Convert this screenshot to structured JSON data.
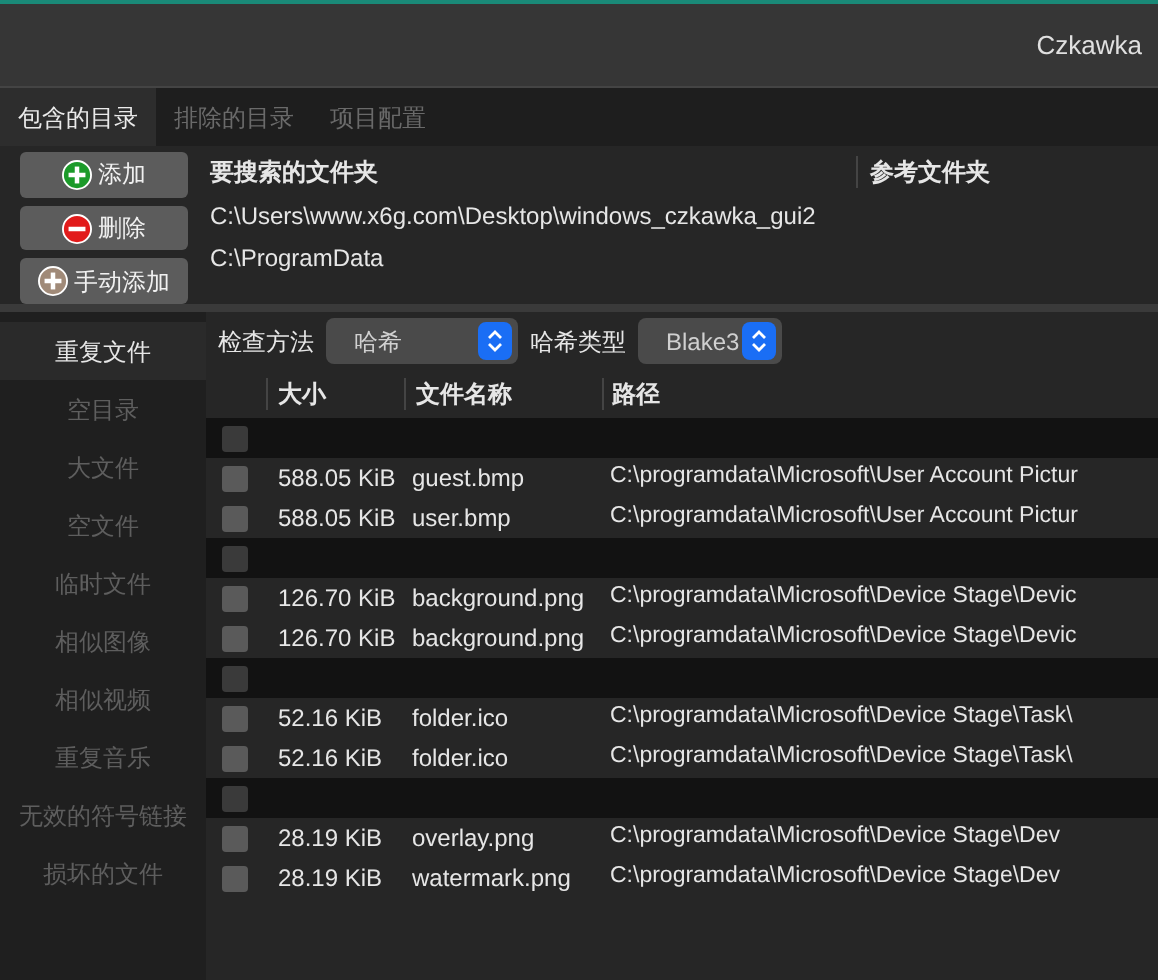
{
  "window": {
    "title": "Czkawka"
  },
  "tabs": [
    {
      "label": "包含的目录",
      "selected": true
    },
    {
      "label": "排除的目录",
      "selected": false
    },
    {
      "label": "项目配置",
      "selected": false
    }
  ],
  "directory_buttons": [
    {
      "label": "添加",
      "kind": "add"
    },
    {
      "label": "删除",
      "kind": "remove"
    },
    {
      "label": "手动添加",
      "kind": "manual"
    }
  ],
  "directories": {
    "columns": [
      "要搜索的文件夹",
      "参考文件夹"
    ],
    "rows": [
      "C:\\Users\\www.x6g.com\\Desktop\\windows_czkawka_gui2",
      "C:\\ProgramData"
    ]
  },
  "sidebar": {
    "items": [
      {
        "label": "重复文件",
        "selected": true
      },
      {
        "label": "空目录",
        "selected": false
      },
      {
        "label": "大文件",
        "selected": false
      },
      {
        "label": "空文件",
        "selected": false
      },
      {
        "label": "临时文件",
        "selected": false
      },
      {
        "label": "相似图像",
        "selected": false
      },
      {
        "label": "相似视频",
        "selected": false
      },
      {
        "label": "重复音乐",
        "selected": false
      },
      {
        "label": "无效的符号链接",
        "selected": false
      },
      {
        "label": "损坏的文件",
        "selected": false
      }
    ]
  },
  "toolbar": [
    {
      "label": "检查方法",
      "value": "哈希"
    },
    {
      "label": "哈希类型",
      "value": "Blake3"
    }
  ],
  "table": {
    "columns": [
      "大小",
      "文件名称",
      "路径"
    ],
    "groups": [
      {
        "checked": false,
        "rows": [
          {
            "checked": false,
            "size": "588.05 KiB",
            "name": "guest.bmp",
            "path": "C:\\programdata\\Microsoft\\User Account Pictur"
          },
          {
            "checked": false,
            "size": "588.05 KiB",
            "name": "user.bmp",
            "path": "C:\\programdata\\Microsoft\\User Account Pictur"
          }
        ]
      },
      {
        "checked": false,
        "rows": [
          {
            "checked": false,
            "size": "126.70 KiB",
            "name": "background.png",
            "path": "C:\\programdata\\Microsoft\\Device Stage\\Devic"
          },
          {
            "checked": false,
            "size": "126.70 KiB",
            "name": "background.png",
            "path": "C:\\programdata\\Microsoft\\Device Stage\\Devic"
          }
        ]
      },
      {
        "checked": false,
        "rows": [
          {
            "checked": false,
            "size": "52.16 KiB",
            "name": "folder.ico",
            "path": "C:\\programdata\\Microsoft\\Device Stage\\Task\\"
          },
          {
            "checked": false,
            "size": "52.16 KiB",
            "name": "folder.ico",
            "path": "C:\\programdata\\Microsoft\\Device Stage\\Task\\"
          }
        ]
      },
      {
        "checked": false,
        "rows": [
          {
            "checked": false,
            "size": "28.19 KiB",
            "name": "overlay.png",
            "path": "C:\\programdata\\Microsoft\\Device Stage\\Dev"
          },
          {
            "checked": false,
            "size": "28.19 KiB",
            "name": "watermark.png",
            "path": "C:\\programdata\\Microsoft\\Device Stage\\Dev"
          }
        ]
      }
    ]
  }
}
